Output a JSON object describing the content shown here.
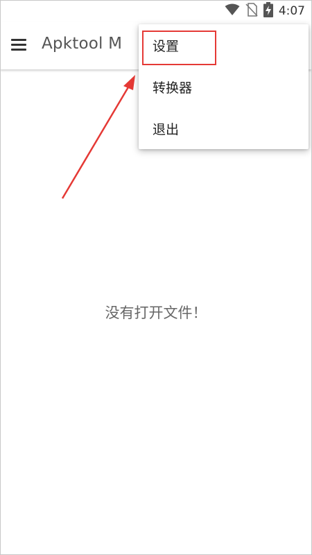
{
  "status_bar": {
    "time": "4:07",
    "icons": [
      "wifi-icon",
      "no-sim-icon",
      "battery-charging-icon"
    ]
  },
  "app_bar": {
    "title": "Apktool M",
    "menu_icon": "hamburger-menu-icon"
  },
  "overflow_menu": {
    "items": [
      {
        "label": "设置"
      },
      {
        "label": "转换器"
      },
      {
        "label": "退出"
      }
    ]
  },
  "main": {
    "empty_message": "没有打开文件！"
  },
  "annotation_colors": {
    "highlight": "#e53935",
    "arrow": "#e53935"
  }
}
